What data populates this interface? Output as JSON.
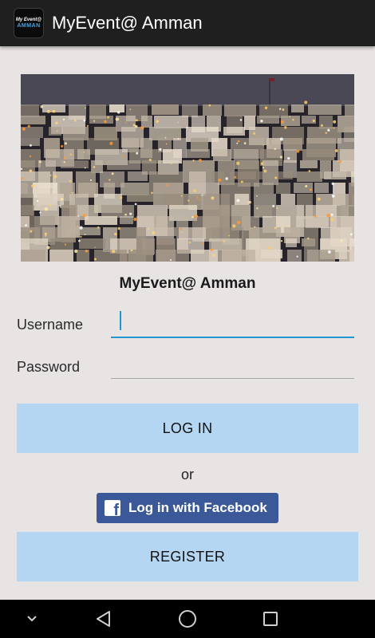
{
  "app_bar": {
    "title": "MyEvent@ Amman",
    "icon_text_top": "My Event@",
    "icon_text_bottom": "AMMAN"
  },
  "hero": {
    "image": "Amman city skyline at night"
  },
  "login_form": {
    "app_name": "MyEvent@ Amman",
    "username_label": "Username",
    "username_value": "",
    "password_label": "Password",
    "password_value": "",
    "login_button": "LOG IN",
    "or_text": "or",
    "facebook_button": "Log in with Facebook",
    "register_button": "REGISTER"
  },
  "nav_bar": {
    "icons": [
      "chevron-down-icon",
      "back-icon",
      "home-icon",
      "recents-icon"
    ]
  },
  "colors": {
    "app_bar": "#1f1f1f",
    "background": "#e8e4e4",
    "button": "#b5d6f2",
    "facebook": "#3b5998",
    "input_focus": "#2196d3"
  }
}
